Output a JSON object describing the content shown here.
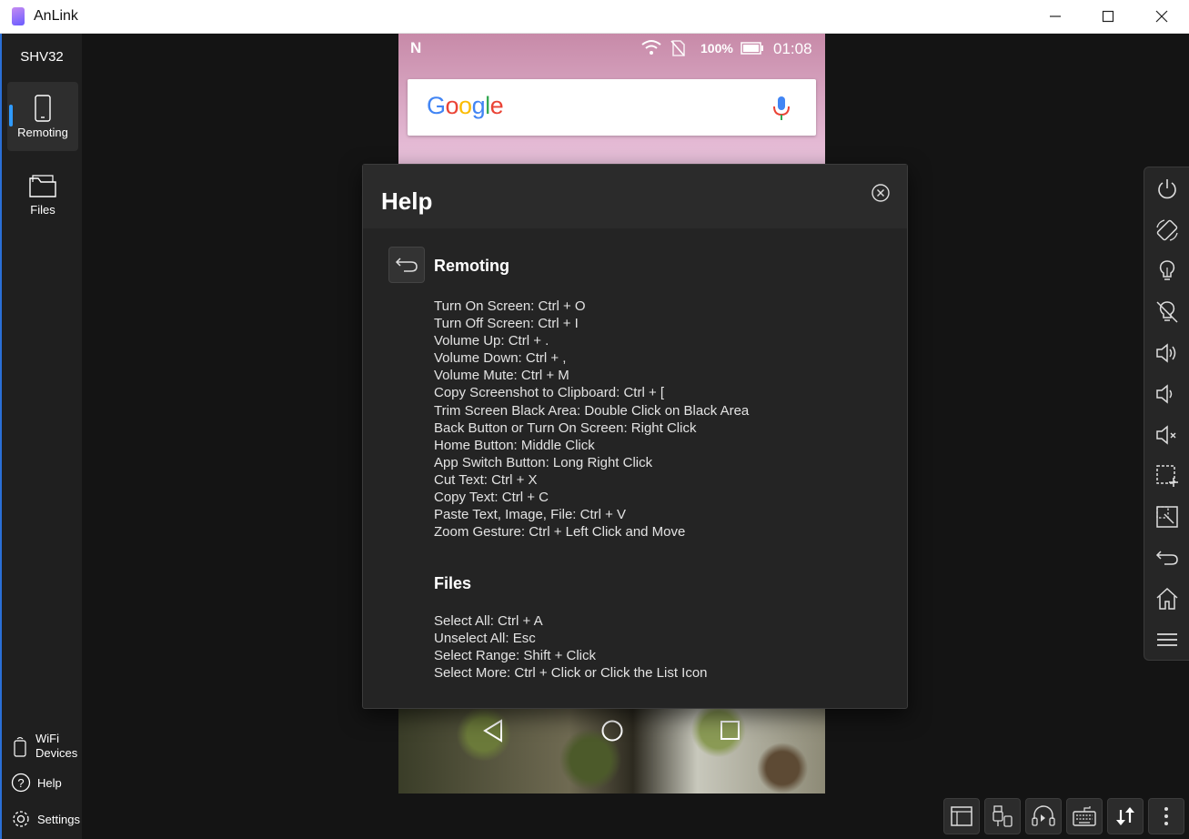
{
  "app": {
    "title": "AnLink"
  },
  "sidebar": {
    "device_name": "SHV32",
    "items": [
      {
        "label": "Remoting",
        "icon": "phone-icon",
        "active": true
      },
      {
        "label": "Files",
        "icon": "folder-icon",
        "active": false
      }
    ],
    "bottom": [
      {
        "label": "WiFi\nDevices",
        "icon": "wifi-device-icon"
      },
      {
        "label": "Help",
        "icon": "help-icon"
      },
      {
        "label": "Settings",
        "icon": "gear-icon"
      }
    ]
  },
  "phone": {
    "status": {
      "battery": "100%",
      "time": "01:08"
    },
    "search_logo": "Google"
  },
  "help_dialog": {
    "title": "Help",
    "sections": [
      {
        "title": "Remoting",
        "items": [
          "Turn On Screen: Ctrl + O",
          "Turn Off Screen: Ctrl + I",
          "Volume Up: Ctrl + .",
          "Volume Down: Ctrl + ,",
          "Volume Mute: Ctrl + M",
          "Copy Screenshot to Clipboard: Ctrl + [",
          "Trim Screen Black Area: Double Click on Black Area",
          "Back Button or Turn On Screen: Right Click",
          "Home Button: Middle Click",
          "App Switch Button: Long Right Click",
          "Cut Text: Ctrl + X",
          "Copy Text: Ctrl + C",
          "Paste Text, Image, File: Ctrl + V",
          "Zoom Gesture: Ctrl + Left Click and Move"
        ]
      },
      {
        "title": "Files",
        "items": [
          "Select All: Ctrl + A",
          "Unselect All: Esc",
          "Select Range: Shift + Click",
          "Select More: Ctrl + Click or Click the List Icon"
        ]
      }
    ]
  },
  "right_toolbar": [
    "power-icon",
    "rotate-icon",
    "screen-on-icon",
    "screen-off-icon",
    "volume-up-icon",
    "volume-down-icon",
    "volume-mute-icon",
    "screenshot-icon",
    "trim-icon",
    "back-icon",
    "home-icon",
    "menu-icon"
  ],
  "bottom_toolbar": [
    "window-layout-icon",
    "usb-icon",
    "audio-icon",
    "keyboard-icon",
    "transfer-icon",
    "more-icon"
  ],
  "colors": {
    "accent": "#2f9bff",
    "background": "#141414",
    "sidebar": "#1f1f1f",
    "dialog": "#242424"
  }
}
